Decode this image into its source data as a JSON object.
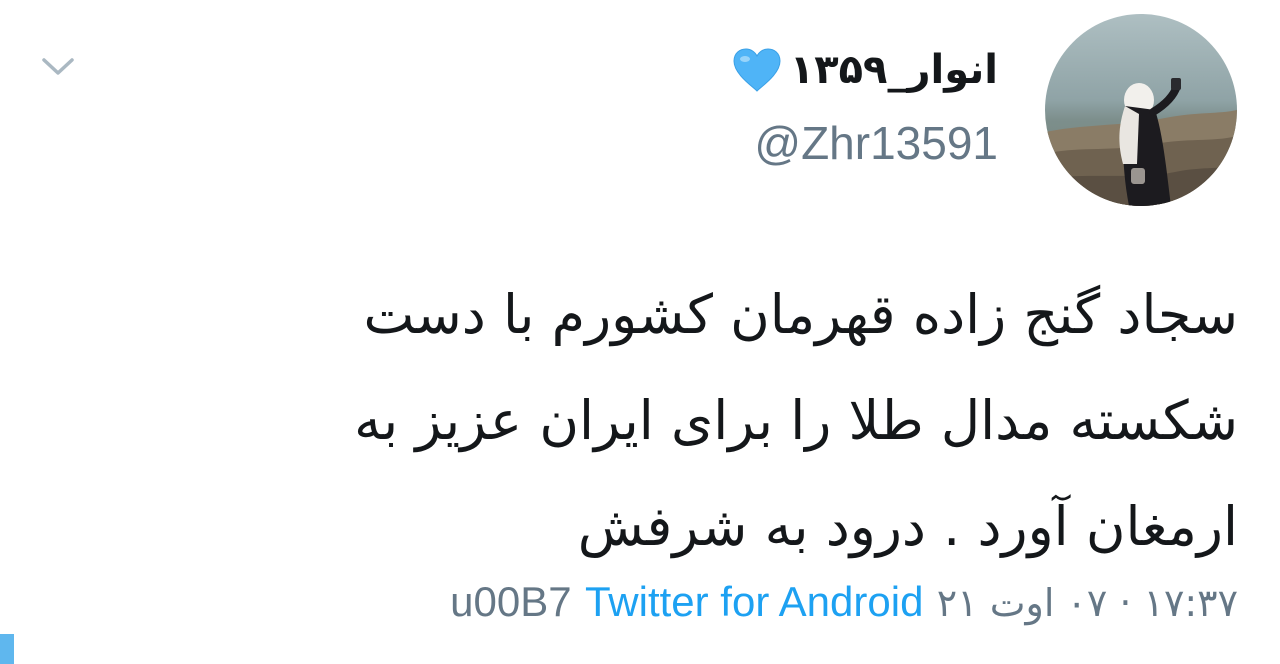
{
  "user": {
    "display_name": "انوار_۱۳۵۹",
    "handle": "@Zhr13591",
    "badge_icon": "blue-heart-icon"
  },
  "tweet": {
    "lines": [
      "سجاد گنج زاده قهرمان کشورم با دست",
      "شکسته مدال طلا را برای ایران عزیز به",
      "ارمغان آورد . درود به شرفش"
    ]
  },
  "meta": {
    "timestamp": "۱۷:۳۷ · ۰۷ اوت ۲۱",
    "separator": "u00B7",
    "source": "Twitter for Android"
  },
  "icons": {
    "menu": "chevron-down-icon",
    "avatar": "avatar"
  },
  "colors": {
    "primary_text": "#14171a",
    "secondary_text": "#657786",
    "link": "#1da1f2",
    "heart": "#4fb4f7",
    "chevron": "#aab8c2"
  }
}
